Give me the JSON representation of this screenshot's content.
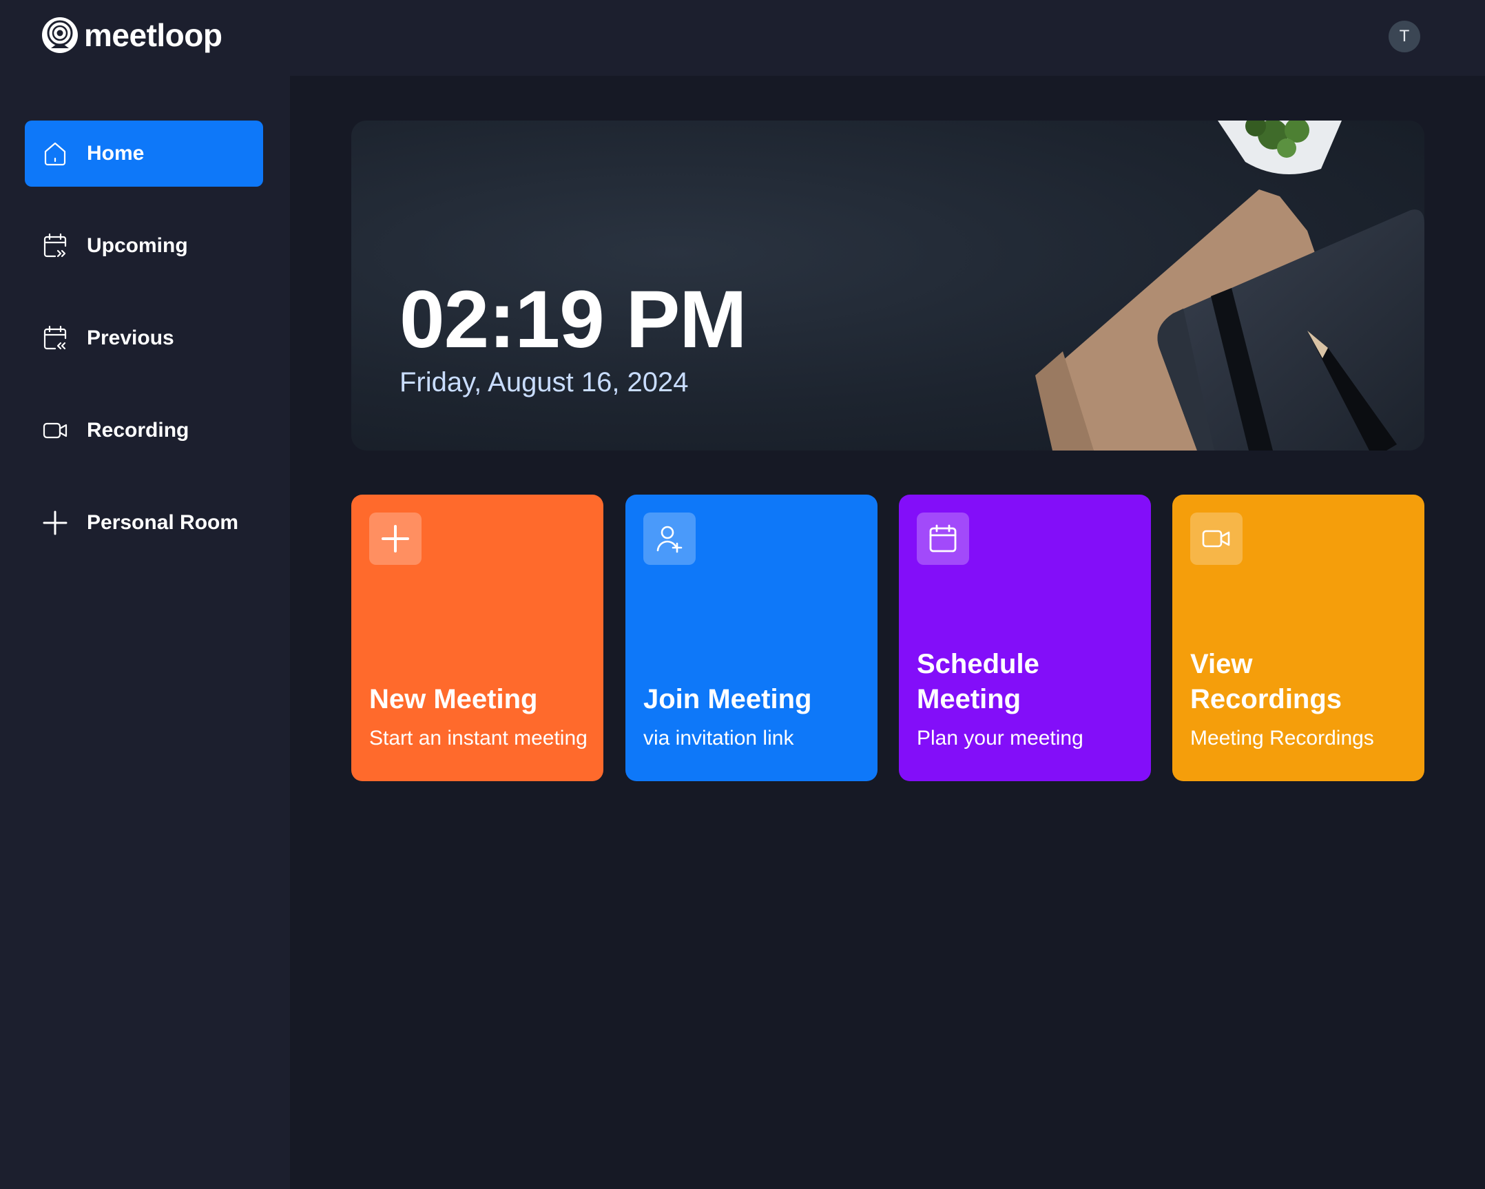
{
  "app": {
    "name": "meetloop"
  },
  "user": {
    "avatar_initial": "T"
  },
  "sidebar": {
    "items": [
      {
        "label": "Home",
        "icon": "home-icon",
        "active": true
      },
      {
        "label": "Upcoming",
        "icon": "calendar-forward-icon",
        "active": false
      },
      {
        "label": "Previous",
        "icon": "calendar-back-icon",
        "active": false
      },
      {
        "label": "Recording",
        "icon": "video-icon",
        "active": false
      },
      {
        "label": "Personal Room",
        "icon": "plus-icon",
        "active": false
      }
    ]
  },
  "hero": {
    "time": "02:19 PM",
    "date": "Friday, August 16, 2024"
  },
  "cards": [
    {
      "title": "New Meeting",
      "subtitle": "Start an instant meeting",
      "icon": "plus-icon",
      "color": "#ff6a2c"
    },
    {
      "title": "Join Meeting",
      "subtitle": "via invitation link",
      "icon": "add-user-icon",
      "color": "#0e78f9"
    },
    {
      "title": "Schedule Meeting",
      "subtitle": "Plan your meeting",
      "icon": "calendar-icon",
      "color": "#830ef9"
    },
    {
      "title": "View Recordings",
      "subtitle": "Meeting Recordings",
      "icon": "video-icon",
      "color": "#f59e0b"
    }
  ],
  "colors": {
    "background": "#161925",
    "panel": "#1c1f2e",
    "accent": "#0e78f9",
    "date_text": "#c9ddff"
  }
}
